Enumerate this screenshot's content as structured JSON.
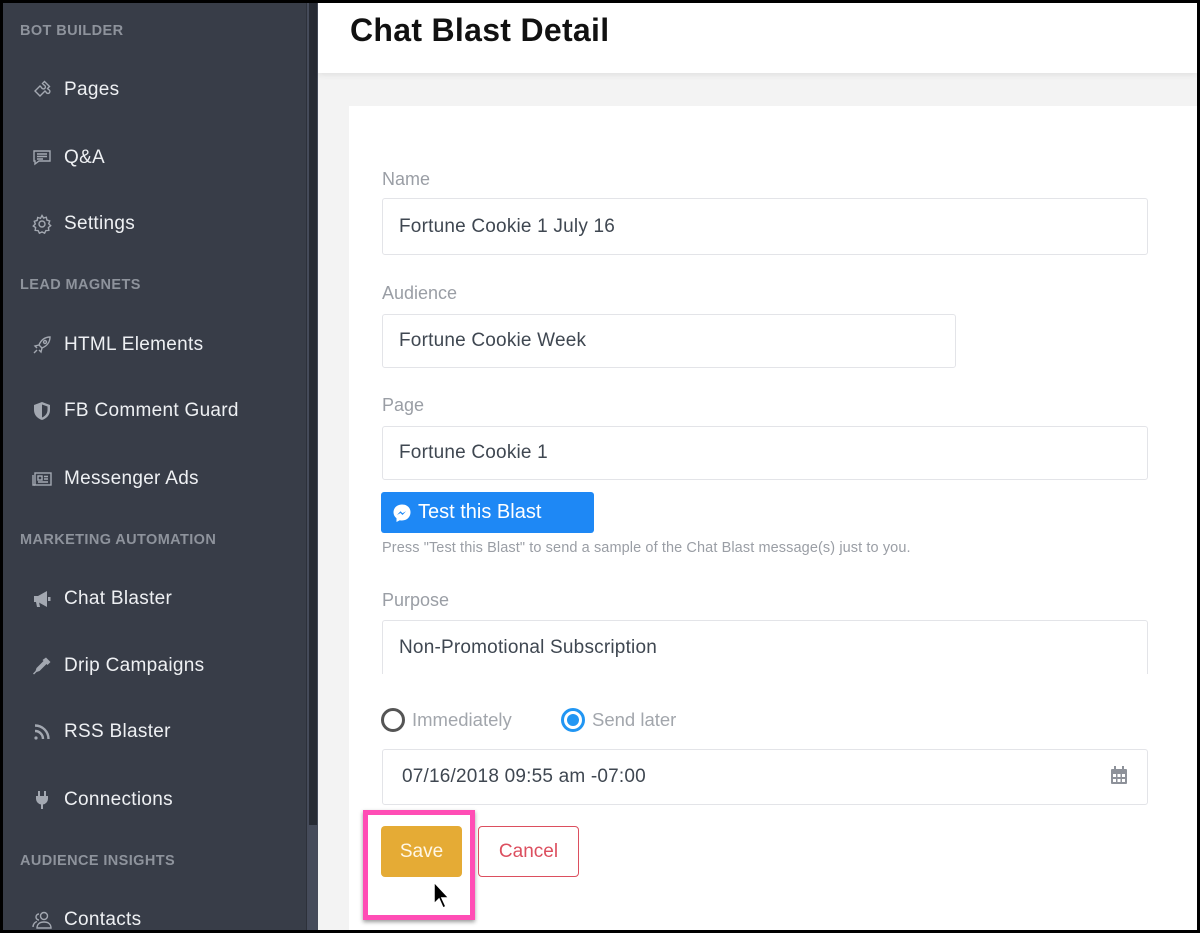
{
  "sidebar": {
    "sections": [
      {
        "title": "BOT BUILDER",
        "items": [
          {
            "label": "Pages",
            "icon": "puzzle-icon"
          },
          {
            "label": "Q&A",
            "icon": "chat-bubble-icon"
          },
          {
            "label": "Settings",
            "icon": "gear-icon"
          }
        ]
      },
      {
        "title": "LEAD MAGNETS",
        "items": [
          {
            "label": "HTML Elements",
            "icon": "rocket-icon"
          },
          {
            "label": "FB Comment Guard",
            "icon": "shield-icon"
          },
          {
            "label": "Messenger Ads",
            "icon": "newspaper-icon"
          }
        ]
      },
      {
        "title": "MARKETING AUTOMATION",
        "items": [
          {
            "label": "Chat Blaster",
            "icon": "megaphone-icon"
          },
          {
            "label": "Drip Campaigns",
            "icon": "eyedropper-icon"
          },
          {
            "label": "RSS Blaster",
            "icon": "rss-icon"
          },
          {
            "label": "Connections",
            "icon": "plug-icon"
          }
        ]
      },
      {
        "title": "AUDIENCE INSIGHTS",
        "items": [
          {
            "label": "Contacts",
            "icon": "users-icon"
          }
        ]
      }
    ]
  },
  "header": {
    "title": "Chat Blast Detail"
  },
  "form": {
    "name": {
      "label": "Name",
      "value": "Fortune Cookie 1 July 16"
    },
    "audience": {
      "label": "Audience",
      "value": "Fortune Cookie Week"
    },
    "page": {
      "label": "Page",
      "value": "Fortune Cookie 1"
    },
    "test_button": "Test this Blast",
    "test_help": "Press \"Test this Blast\" to send a sample of the Chat Blast message(s) just to you.",
    "purpose": {
      "label": "Purpose",
      "value": "Non-Promotional Subscription"
    },
    "timing": {
      "options": [
        "Immediately",
        "Send later"
      ],
      "selected": "Send later"
    },
    "datetime": "07/16/2018 09:55 am -07:00",
    "save_label": "Save",
    "cancel_label": "Cancel"
  },
  "colors": {
    "sidebar_bg": "#383d48",
    "primary_blue": "#1e88f5",
    "save_yellow": "#e5ab35",
    "cancel_red": "#dc4f5f",
    "highlight_pink": "#ff4db5"
  }
}
